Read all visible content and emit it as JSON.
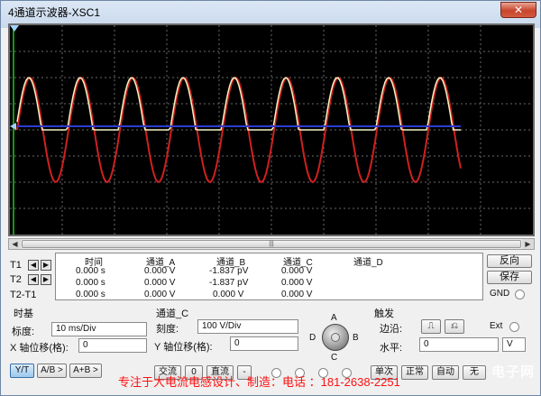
{
  "window": {
    "title": "4通道示波器-XSC1",
    "close_glyph": "✕"
  },
  "scope": {
    "colors": {
      "channel_a": "#d02020",
      "channel_b": "#f2f2c0",
      "channel_c": "#2c3cd0",
      "grid": "#6a6a6a",
      "trigger_marker": "#9fd3ff",
      "cursor": "#1ec81e"
    },
    "scroll_grip": "|||"
  },
  "cursors": {
    "t1": "T1",
    "t2": "T2",
    "t2_t1": "T2-T1"
  },
  "table": {
    "headers": [
      "时间",
      "通道_A",
      "通道_B",
      "通道_C",
      "通道_D"
    ],
    "rows": [
      [
        "0.000 s",
        "0.000 V",
        "-1.837 pV",
        "0.000 V",
        ""
      ],
      [
        "0.000 s",
        "0.000 V",
        "-1.837 pV",
        "0.000 V",
        ""
      ],
      [
        "0.000 s",
        "0.000 V",
        "0.000 V",
        "0.000 V",
        ""
      ]
    ]
  },
  "side": {
    "reverse": "反向",
    "save": "保存",
    "gnd": "GND"
  },
  "timebase": {
    "title": "时基",
    "scale_label": "标度:",
    "scale_value": "10 ms/Div",
    "xpos_label": "X 轴位移(格):",
    "xpos_value": "0",
    "modes": [
      "Y/T",
      "A/B >",
      "A+B >"
    ]
  },
  "channel": {
    "title": "通道_C",
    "scale_label": "刻度:",
    "scale_value": "100  V/Div",
    "ypos_label": "Y 轴位移(格):",
    "ypos_value": "0",
    "coupling": [
      "交流",
      "0",
      "直流"
    ],
    "extra_btn": "-",
    "knob_labels": {
      "a": "A",
      "b": "B",
      "c": "C",
      "d": "D"
    }
  },
  "trigger": {
    "title": "触发",
    "edge_label": "边沿:",
    "ext_label": "Ext",
    "level_label": "水平:",
    "level_value": "0",
    "level_unit": "V",
    "modes": [
      "单次",
      "正常",
      "自动",
      "无"
    ]
  },
  "watermark": {
    "text": "专注于大电流电感设计、制造：电话 ：181-2638-2251",
    "logo": "电子网"
  }
}
